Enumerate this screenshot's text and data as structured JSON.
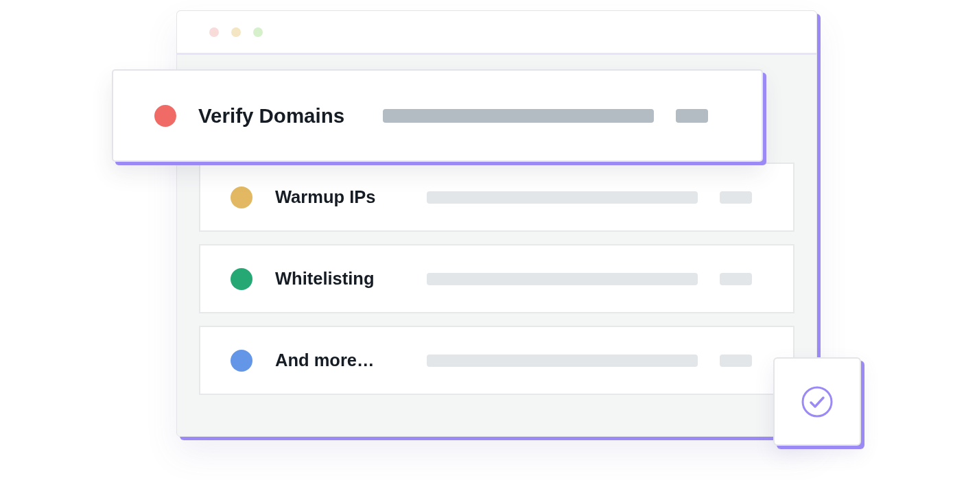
{
  "tasks": [
    {
      "label": "Verify Domains",
      "color": "#f06b66",
      "selected": true
    },
    {
      "label": "Warmup IPs",
      "color": "#e2b862",
      "selected": false
    },
    {
      "label": "Whitelisting",
      "color": "#26a874",
      "selected": false
    },
    {
      "label": "And more…",
      "color": "#6496e8",
      "selected": false
    }
  ]
}
